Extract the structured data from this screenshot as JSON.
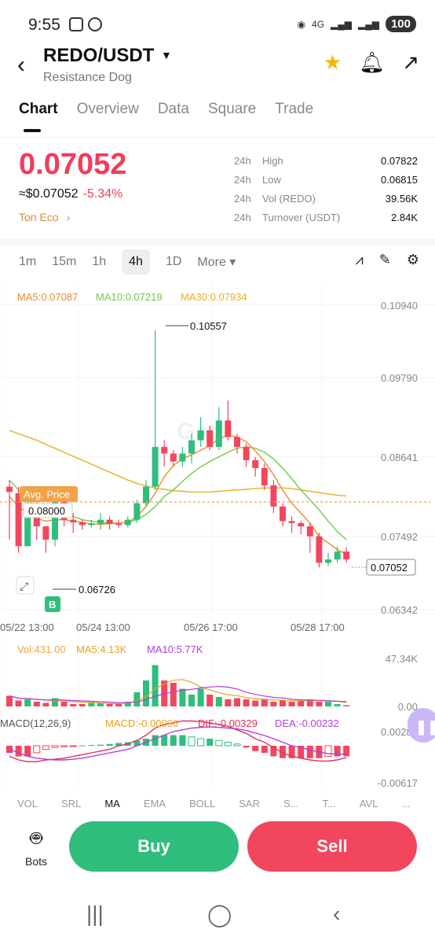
{
  "status": {
    "time": "9:55",
    "network": "4G",
    "battery": "100"
  },
  "header": {
    "pair": "REDO/USDT",
    "name": "Resistance Dog"
  },
  "tabs": [
    "Chart",
    "Overview",
    "Data",
    "Square",
    "Trade"
  ],
  "price": {
    "last": "0.07052",
    "usd": "≈$0.07052",
    "change": "-5.34%",
    "eco": "Ton Eco"
  },
  "stats": [
    {
      "period": "24h",
      "label": "High",
      "value": "0.07822"
    },
    {
      "period": "24h",
      "label": "Low",
      "value": "0.06815"
    },
    {
      "period": "24h",
      "label": "Vol (REDO)",
      "value": "39.56K"
    },
    {
      "period": "24h",
      "label": "Turnover (USDT)",
      "value": "2.84K"
    }
  ],
  "timeframes": [
    "1m",
    "15m",
    "1h",
    "4h",
    "1D",
    "More ▾"
  ],
  "active_timeframe": "4h",
  "ma_legend": {
    "ma5": "MA5:0.07087",
    "ma10": "MA10:0.07219",
    "ma30": "MA30:0.07934"
  },
  "vol_legend": {
    "vol": "Vol:431.00",
    "ma5": "MA5:4.13K",
    "ma10": "MA10:5.77K"
  },
  "macd_legend": {
    "title": "MACD(12,26,9)",
    "macd": "MACD:-0.00096",
    "dif": "DIF:-0.00329",
    "dea": "DEA:-0.00232"
  },
  "labels": {
    "avg_price": "Avg. Price",
    "avg_value": "0.08000",
    "high_mark": "0.10557",
    "low_mark": "0.06726",
    "current": "0.07052",
    "b_marker": "B",
    "watermark": "Gate"
  },
  "indicator_tabs": [
    "VOL",
    "SRL",
    "MA",
    "EMA",
    "BOLL",
    "SAR",
    "S...",
    "T...",
    "AVL",
    "..."
  ],
  "buttons": {
    "bots": "Bots",
    "buy": "Buy",
    "sell": "Sell"
  },
  "colors": {
    "up": "#2fbe7c",
    "down": "#f2465e",
    "ma5": "#f08a2a",
    "ma10": "#6dcc4a",
    "ma30": "#e8b020"
  },
  "chart_data": {
    "type": "candlestick",
    "price_axis": [
      "0.10940",
      "0.09790",
      "0.08641",
      "0.07492",
      "0.06342"
    ],
    "ylim": [
      0.06342,
      0.1094
    ],
    "x_ticks": [
      "05/22 13:00",
      "05/24 13:00",
      "05/26 17:00",
      "05/28 17:00"
    ],
    "vol_axis": [
      "47.34K",
      "0.00"
    ],
    "macd_axis": [
      "0.00281",
      "-0.00617"
    ],
    "candles": [
      [
        0.082,
        0.0812,
        0.083,
        0.074
      ],
      [
        0.081,
        0.073,
        0.082,
        0.072
      ],
      [
        0.073,
        0.079,
        0.08,
        0.073
      ],
      [
        0.079,
        0.076,
        0.08,
        0.074
      ],
      [
        0.076,
        0.074,
        0.076,
        0.072
      ],
      [
        0.074,
        0.08,
        0.081,
        0.073
      ],
      [
        0.08,
        0.077,
        0.081,
        0.076
      ],
      [
        0.077,
        0.0766,
        0.078,
        0.075
      ],
      [
        0.0766,
        0.0762,
        0.077,
        0.0755
      ],
      [
        0.0762,
        0.0764,
        0.077,
        0.0758
      ],
      [
        0.0764,
        0.077,
        0.078,
        0.0755
      ],
      [
        0.077,
        0.0764,
        0.0775,
        0.0755
      ],
      [
        0.0764,
        0.0762,
        0.077,
        0.0758
      ],
      [
        0.0762,
        0.077,
        0.0775,
        0.0758
      ],
      [
        0.077,
        0.0795,
        0.08,
        0.0765
      ],
      [
        0.0795,
        0.082,
        0.083,
        0.079
      ],
      [
        0.082,
        0.088,
        0.1056,
        0.0815
      ],
      [
        0.088,
        0.087,
        0.089,
        0.085
      ],
      [
        0.087,
        0.0858,
        0.0875,
        0.085
      ],
      [
        0.0858,
        0.087,
        0.088,
        0.085
      ],
      [
        0.087,
        0.089,
        0.09,
        0.0855
      ],
      [
        0.089,
        0.0905,
        0.0925,
        0.088
      ],
      [
        0.0905,
        0.088,
        0.0912,
        0.0875
      ],
      [
        0.088,
        0.092,
        0.094,
        0.0875
      ],
      [
        0.092,
        0.0895,
        0.095,
        0.089
      ],
      [
        0.0895,
        0.088,
        0.09,
        0.087
      ],
      [
        0.088,
        0.086,
        0.0885,
        0.085
      ],
      [
        0.086,
        0.0848,
        0.0865,
        0.0835
      ],
      [
        0.0848,
        0.0822,
        0.0855,
        0.0815
      ],
      [
        0.0822,
        0.079,
        0.083,
        0.078
      ],
      [
        0.079,
        0.0768,
        0.0795,
        0.076
      ],
      [
        0.0768,
        0.0765,
        0.0775,
        0.075
      ],
      [
        0.0765,
        0.076,
        0.0768,
        0.0748
      ],
      [
        0.076,
        0.0745,
        0.0765,
        0.072
      ],
      [
        0.0745,
        0.0705,
        0.075,
        0.0698
      ],
      [
        0.0705,
        0.071,
        0.072,
        0.07
      ],
      [
        0.071,
        0.0722,
        0.073,
        0.0705
      ],
      [
        0.0722,
        0.071,
        0.0728,
        0.0705
      ]
    ],
    "ma5": [
      0.0805,
      0.079,
      0.078,
      0.0772,
      0.0768,
      0.077,
      0.077,
      0.0768,
      0.0766,
      0.0764,
      0.0763,
      0.0764,
      0.0765,
      0.0766,
      0.0775,
      0.079,
      0.081,
      0.0835,
      0.0852,
      0.0862,
      0.0868,
      0.0875,
      0.0882,
      0.0892,
      0.0898,
      0.0895,
      0.0888,
      0.0874,
      0.0858,
      0.0838,
      0.0815,
      0.0795,
      0.078,
      0.0765,
      0.0745,
      0.0735,
      0.0725,
      0.0718
    ],
    "ma10": [
      0.083,
      0.0815,
      0.08,
      0.079,
      0.0785,
      0.0783,
      0.078,
      0.0775,
      0.077,
      0.0768,
      0.0766,
      0.0765,
      0.0765,
      0.0766,
      0.077,
      0.0778,
      0.079,
      0.0805,
      0.0815,
      0.0828,
      0.084,
      0.085,
      0.0858,
      0.0865,
      0.0872,
      0.0878,
      0.088,
      0.0878,
      0.0872,
      0.0862,
      0.0848,
      0.0832,
      0.0815,
      0.08,
      0.0785,
      0.0768,
      0.0752,
      0.074
    ],
    "ma30": [
      0.0905,
      0.09,
      0.0895,
      0.089,
      0.0884,
      0.0878,
      0.0872,
      0.0866,
      0.086,
      0.0854,
      0.0848,
      0.0842,
      0.0836,
      0.083,
      0.0825,
      0.0821,
      0.0818,
      0.0816,
      0.0814,
      0.0813,
      0.0812,
      0.0812,
      0.0812,
      0.0813,
      0.0814,
      0.0815,
      0.0816,
      0.0817,
      0.0818,
      0.0818,
      0.0818,
      0.0817,
      0.0815,
      0.0813,
      0.0811,
      0.0809,
      0.0807,
      0.0806
    ],
    "volumes": [
      9,
      5,
      6,
      4,
      3,
      7,
      4,
      2,
      2,
      3,
      3,
      2,
      2,
      4,
      12,
      22,
      35,
      22,
      20,
      15,
      10,
      15,
      10,
      8,
      6,
      7,
      6,
      5,
      6,
      4,
      5,
      4,
      5,
      6,
      4,
      4,
      2,
      1
    ],
    "macd_hist": [
      -2,
      -3,
      -3,
      -2,
      -1,
      -0.5,
      -0.3,
      -0.2,
      0.1,
      0.2,
      0.3,
      0.5,
      0.8,
      1,
      1.5,
      2,
      3,
      3,
      3,
      3,
      2.5,
      2,
      2,
      1.5,
      1,
      0.5,
      -0.5,
      -1.5,
      -2,
      -3,
      -3.5,
      -3.5,
      -3.5,
      -3.5,
      -3.5,
      -3,
      -3,
      -3
    ],
    "dif": [
      -3,
      -4,
      -4.5,
      -4.5,
      -4,
      -3.8,
      -3.5,
      -3,
      -2.5,
      -2,
      -1.5,
      -1,
      0,
      0.5,
      1.5,
      3,
      5,
      6,
      6.5,
      7,
      7,
      6.8,
      6.5,
      6,
      5.5,
      4.5,
      3.5,
      2,
      1,
      -0.5,
      -2,
      -3,
      -3.5,
      -4,
      -4.3,
      -4.3,
      -4,
      -3.3
    ],
    "dea": [
      -1,
      -2,
      -3,
      -3.5,
      -3.8,
      -4,
      -4,
      -3.8,
      -3.5,
      -3,
      -2.5,
      -2,
      -1.5,
      -1,
      0,
      1,
      2,
      3,
      4,
      4.5,
      5,
      5.2,
      5.3,
      5.2,
      5,
      4.8,
      4.3,
      3.6,
      2.9,
      2,
      1,
      0,
      -0.5,
      -1.2,
      -1.8,
      -2.2,
      -2.4,
      -2.3
    ]
  }
}
